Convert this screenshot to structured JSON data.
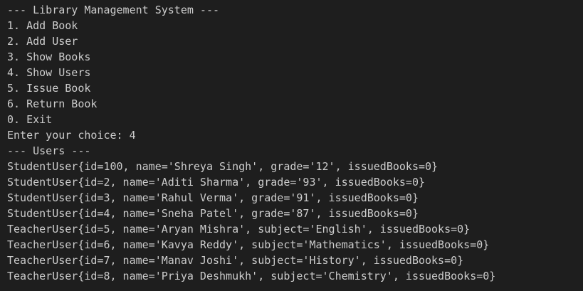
{
  "terminal": {
    "lines": [
      "--- Library Management System ---",
      "1. Add Book",
      "2. Add User",
      "3. Show Books",
      "4. Show Users",
      "5. Issue Book",
      "6. Return Book",
      "0. Exit",
      "Enter your choice: 4",
      "--- Users ---",
      "StudentUser{id=100, name='Shreya Singh', grade='12', issuedBooks=0}",
      "StudentUser{id=2, name='Aditi Sharma', grade='93', issuedBooks=0}",
      "StudentUser{id=3, name='Rahul Verma', grade='91', issuedBooks=0}",
      "StudentUser{id=4, name='Sneha Patel', grade='87', issuedBooks=0}",
      "TeacherUser{id=5, name='Aryan Mishra', subject='English', issuedBooks=0}",
      "TeacherUser{id=6, name='Kavya Reddy', subject='Mathematics', issuedBooks=0}",
      "TeacherUser{id=7, name='Manav Joshi', subject='History', issuedBooks=0}",
      "TeacherUser{id=8, name='Priya Deshmukh', subject='Chemistry', issuedBooks=0}"
    ]
  },
  "colors": {
    "background": "#1e1e1e",
    "text": "#cccccc"
  }
}
